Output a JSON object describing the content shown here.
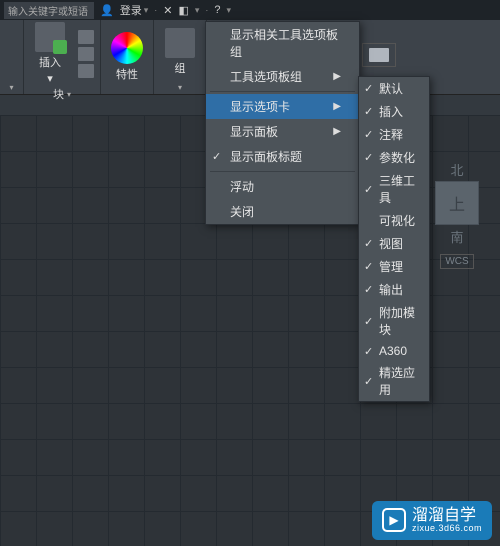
{
  "topbar": {
    "search_placeholder": "输入关键字或短语",
    "login_label": "登录"
  },
  "ribbon": {
    "panel_block": {
      "insert_label": "插入",
      "title": "块"
    },
    "panel_props": {
      "title": "特性"
    },
    "panel_group": {
      "title": "组"
    }
  },
  "menu1": {
    "items": [
      {
        "label": "显示相关工具选项板组",
        "check": false,
        "arrow": false
      },
      {
        "label": "工具选项板组",
        "check": false,
        "arrow": true
      },
      {
        "sep": true
      },
      {
        "label": "显示选项卡",
        "check": false,
        "arrow": true,
        "highlight": true
      },
      {
        "label": "显示面板",
        "check": false,
        "arrow": true
      },
      {
        "label": "显示面板标题",
        "check": true,
        "arrow": false
      },
      {
        "sep": true
      },
      {
        "label": "浮动",
        "check": false,
        "arrow": false
      },
      {
        "label": "关闭",
        "check": false,
        "arrow": false
      }
    ]
  },
  "menu2": {
    "items": [
      {
        "label": "默认",
        "check": true
      },
      {
        "label": "插入",
        "check": true
      },
      {
        "label": "注释",
        "check": true
      },
      {
        "label": "参数化",
        "check": true
      },
      {
        "label": "三维工具",
        "check": true
      },
      {
        "label": "可视化",
        "check": false
      },
      {
        "label": "视图",
        "check": true
      },
      {
        "label": "管理",
        "check": true
      },
      {
        "label": "输出",
        "check": true
      },
      {
        "label": "附加模块",
        "check": true
      },
      {
        "label": "A360",
        "check": true
      },
      {
        "label": "精选应用",
        "check": true
      }
    ]
  },
  "viewcube": {
    "north": "北",
    "top": "上",
    "south": "南",
    "wcs": "WCS"
  },
  "watermark": {
    "brand": "溜溜自学",
    "url": "zixue.3d66.com"
  }
}
